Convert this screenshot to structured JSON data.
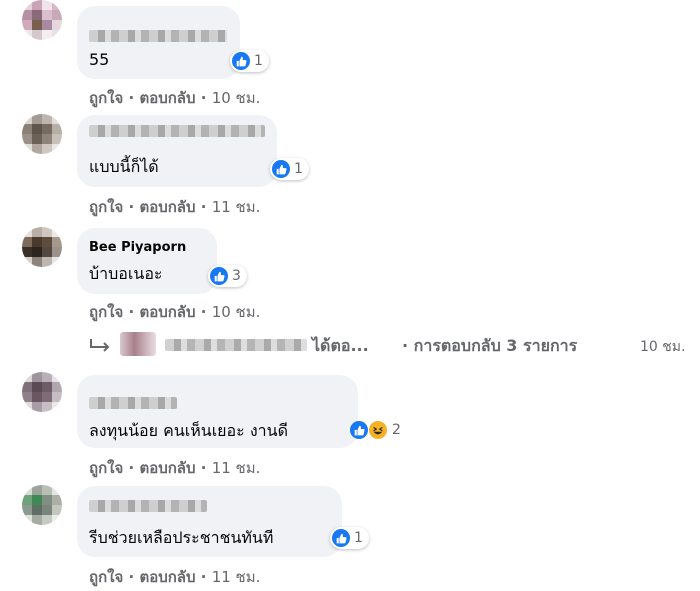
{
  "colors": {
    "bubble": "#f0f2f5",
    "like": "#1877f2",
    "haha": "#f7b125",
    "meta": "#65676b"
  },
  "labels": {
    "like": "ถูกใจ",
    "reply": "ตอบกลับ",
    "separator": "·"
  },
  "comments": [
    {
      "author": "",
      "text": "55",
      "reactions": [
        "like-icon"
      ],
      "reaction_count": "1",
      "time": "10 ชม."
    },
    {
      "author": "",
      "text": "แบบนี้ก็ได้",
      "reactions": [
        "like-icon"
      ],
      "reaction_count": "1",
      "time": "11 ชม."
    },
    {
      "author": "Bee Piyaporn",
      "text": "บ้าบอเนอะ",
      "reactions": [
        "like-icon"
      ],
      "reaction_count": "3",
      "time": "10 ชม."
    },
    {
      "author": "",
      "text": "ลงทุนน้อย คนเห็นเยอะ งานดี",
      "reactions": [
        "like-icon",
        "haha-icon"
      ],
      "reaction_count": "2",
      "time": "11 ชม."
    },
    {
      "author": "",
      "text": "รีบช่วยเหลือประชาชนทันที",
      "reactions": [
        "like-icon"
      ],
      "reaction_count": "1",
      "time": "11 ชม."
    }
  ],
  "replies": {
    "replied_text": "ได้ตอ...",
    "count_label": "· การตอบกลับ 3 รายการ",
    "time": "10 ชม."
  }
}
